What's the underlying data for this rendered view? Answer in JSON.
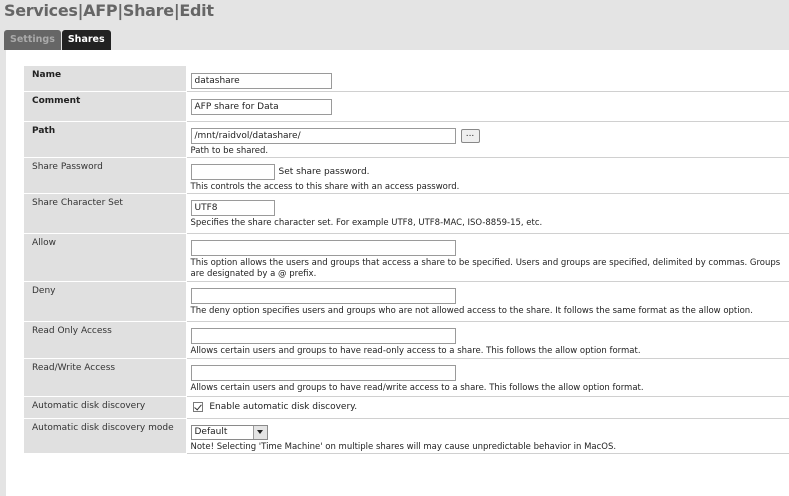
{
  "page": {
    "title": "Services|AFP|Share|Edit"
  },
  "tabs": [
    {
      "label": "Settings",
      "active": false
    },
    {
      "label": "Shares",
      "active": true
    }
  ],
  "form": {
    "name": {
      "label": "Name",
      "value": "datashare"
    },
    "comment": {
      "label": "Comment",
      "value": "AFP share for Data"
    },
    "path": {
      "label": "Path",
      "value": "/mnt/raidvol/datashare/",
      "browse_label": "...",
      "description": "Path to be shared."
    },
    "share_password": {
      "label": "Share Password",
      "value": "",
      "inline_note": "Set share password.",
      "description": "This controls the access to this share with an access password."
    },
    "charset": {
      "label": "Share Character Set",
      "value": "UTF8",
      "description": "Specifies the share character set. For example UTF8, UTF8-MAC, ISO-8859-15, etc."
    },
    "allow": {
      "label": "Allow",
      "value": "",
      "description": "This option allows the users and groups that access a share to be specified. Users and groups are specified, delimited by commas. Groups are designated by a @ prefix."
    },
    "deny": {
      "label": "Deny",
      "value": "",
      "description": "The deny option specifies users and groups who are not allowed access to the share. It follows the same format as the allow option."
    },
    "read_only": {
      "label": "Read Only Access",
      "value": "",
      "description": "Allows certain users and groups to have read-only access to a share. This follows the allow option format."
    },
    "read_write": {
      "label": "Read/Write Access",
      "value": "",
      "description": "Allows certain users and groups to have read/write access to a share. This follows the allow option format."
    },
    "auto_discovery": {
      "label": "Automatic disk discovery",
      "checked": true,
      "checkbox_label": "Enable automatic disk discovery."
    },
    "auto_discovery_mode": {
      "label": "Automatic disk discovery mode",
      "selected": "Default",
      "description": "Note! Selecting 'Time Machine' on multiple shares will may cause unpredictable behavior in MacOS."
    }
  }
}
